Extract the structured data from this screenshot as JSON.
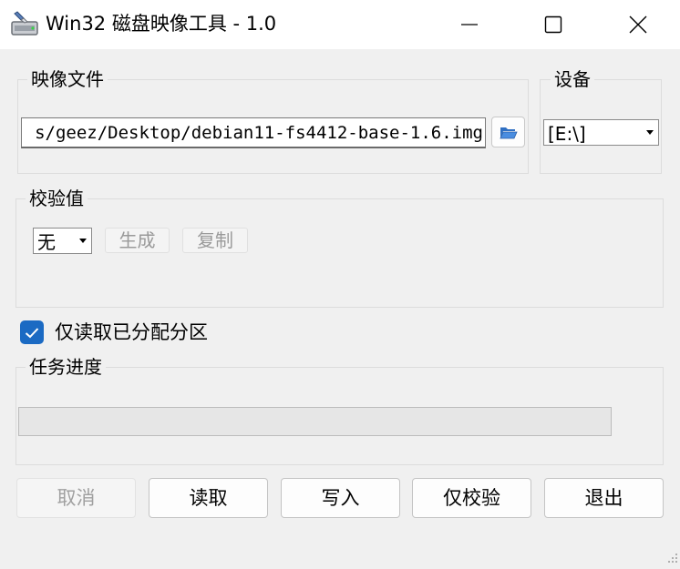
{
  "window": {
    "title": "Win32 磁盘映像工具 - 1.0",
    "icons": [
      "app-disk-icon",
      "minimize-icon",
      "maximize-icon",
      "close-icon"
    ]
  },
  "image_file": {
    "label": "映像文件",
    "path_visible": "s/geez/Desktop/debian11-fs4412-base-1.6.img",
    "browse_icon": "folder-open-icon"
  },
  "device": {
    "label": "设备",
    "selected": "[E:\\]"
  },
  "hash": {
    "label": "校验值",
    "selected": "无",
    "generate_label": "生成",
    "copy_label": "复制"
  },
  "read_only_partitions": {
    "label": "仅读取已分配分区",
    "checked": true
  },
  "progress": {
    "label": "任务进度",
    "value_percent": 0
  },
  "actions": {
    "cancel": "取消",
    "read": "读取",
    "write": "写入",
    "verify_only": "仅校验",
    "exit": "退出"
  },
  "colors": {
    "accent": "#1b6ac3",
    "progress_fill": "#06b025"
  }
}
